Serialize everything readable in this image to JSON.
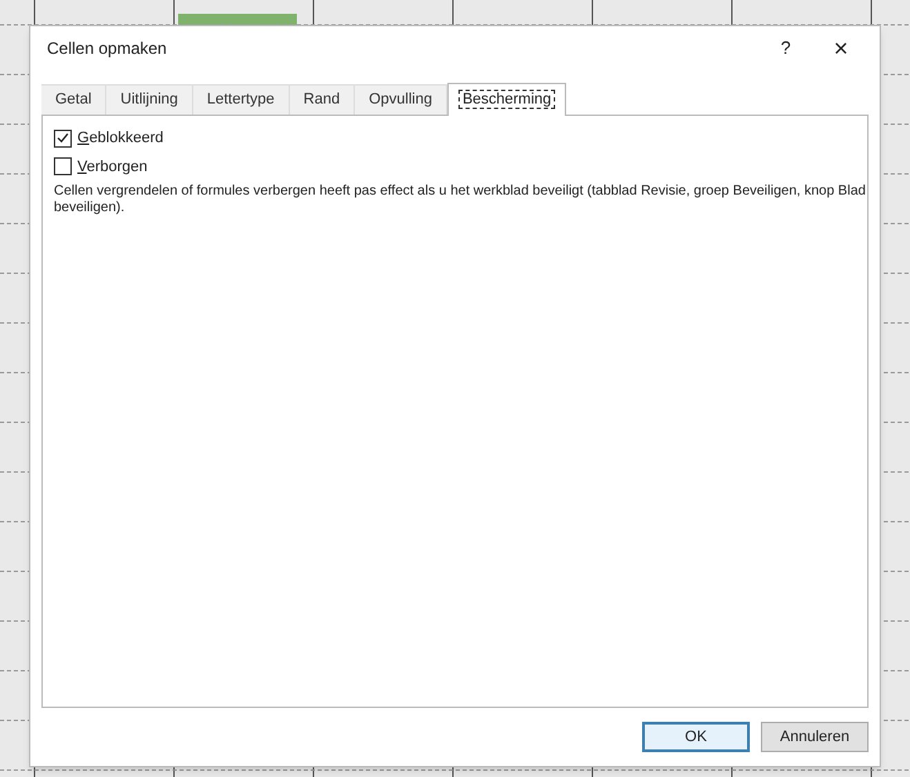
{
  "window": {
    "title": "Cellen opmaken",
    "help": "?",
    "close": "×"
  },
  "tabs": [
    {
      "label": "Getal",
      "selected": false
    },
    {
      "label": "Uitlijning",
      "selected": false
    },
    {
      "label": "Lettertype",
      "selected": false
    },
    {
      "label": "Rand",
      "selected": false
    },
    {
      "label": "Opvulling",
      "selected": false
    },
    {
      "label": "Bescherming",
      "selected": true
    }
  ],
  "options": [
    {
      "label": "Geblokkeerd",
      "checked": true
    },
    {
      "label": "Verborgen",
      "checked": false
    }
  ],
  "note": "Cellen vergrendelen of formules verbergen heeft pas effect als u het werkblad beveiligt (tabblad Revisie, groep Beveiligen, knop Blad beveiligen).",
  "buttons": [
    {
      "label": "OK",
      "kind": "default"
    },
    {
      "label": "Annuleren",
      "kind": "normal"
    }
  ]
}
